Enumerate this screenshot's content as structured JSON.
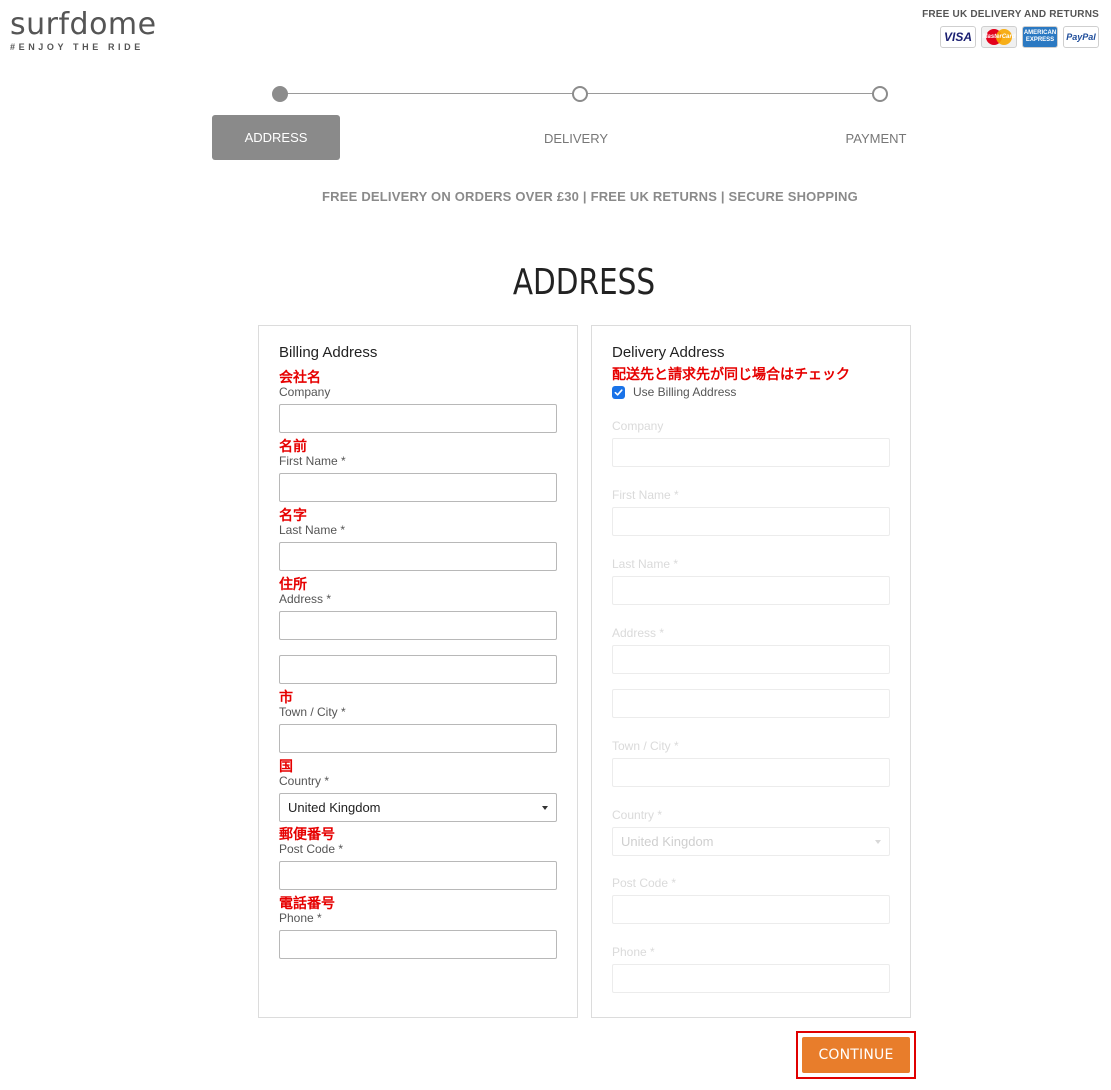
{
  "header": {
    "logo_word": "surfdome",
    "logo_tagline": "#ENJOY THE RIDE",
    "promo": "FREE UK DELIVERY AND RETURNS",
    "payment_cards": {
      "visa": "VISA",
      "mastercard": "MasterCard",
      "amex_top": "AMERICAN",
      "amex_bottom": "EXPRESS",
      "paypal": "PayPal"
    }
  },
  "steps": [
    {
      "label": "ADDRESS",
      "active": true
    },
    {
      "label": "DELIVERY",
      "active": false
    },
    {
      "label": "PAYMENT",
      "active": false
    }
  ],
  "benefits": "FREE DELIVERY ON ORDERS OVER £30 | FREE UK RETURNS | SECURE SHOPPING",
  "page_title": "ADDRESS",
  "billing": {
    "title": "Billing Address",
    "fields": [
      {
        "jp": "会社名",
        "label": "Company",
        "required": false,
        "value": ""
      },
      {
        "jp": "名前",
        "label": "First Name",
        "required": true,
        "value": ""
      },
      {
        "jp": "名字",
        "label": "Last Name",
        "required": true,
        "value": ""
      },
      {
        "jp": "住所",
        "label": "Address",
        "required": true,
        "value": "",
        "value2": ""
      },
      {
        "jp": "市",
        "label": "Town / City",
        "required": true,
        "value": ""
      },
      {
        "jp": "国",
        "label": "Country",
        "required": true,
        "value": "United Kingdom"
      },
      {
        "jp": "郵便番号",
        "label": "Post Code",
        "required": true,
        "value": ""
      },
      {
        "jp": "電話番号",
        "label": "Phone",
        "required": true,
        "value": ""
      }
    ],
    "required_mark": "*"
  },
  "delivery": {
    "title": "Delivery Address",
    "jp_note": "配送先と請求先が同じ場合はチェック",
    "use_billing_label": "Use Billing Address",
    "use_billing_checked": true,
    "fields": [
      {
        "label": "Company"
      },
      {
        "label": "First Name"
      },
      {
        "label": "Last Name"
      },
      {
        "label": "Address"
      },
      {
        "label": "Town / City"
      },
      {
        "label": "Country",
        "value": "United Kingdom"
      },
      {
        "label": "Post Code"
      },
      {
        "label": "Phone"
      }
    ]
  },
  "continue_label": "CONTINUE",
  "colors": {
    "accent": "#e87d2b",
    "annotation_red": "#e60000",
    "step_active": "#8a8a8a",
    "checkbox": "#1a73e8"
  }
}
